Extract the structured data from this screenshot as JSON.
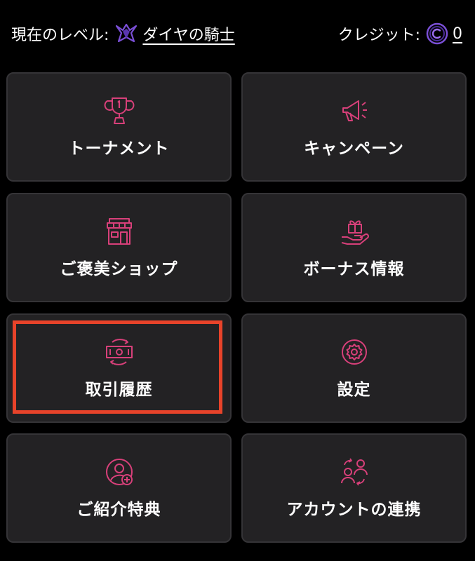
{
  "header": {
    "level_label": "現在のレベル:",
    "level_name": "ダイヤの騎士",
    "level_icon": "knight-crest-icon",
    "credit_label": "クレジット:",
    "credit_value": "0",
    "credit_icon": "coin-icon"
  },
  "menu": [
    {
      "label": "トーナメント",
      "icon": "trophy-icon"
    },
    {
      "label": "キャンペーン",
      "icon": "megaphone-icon"
    },
    {
      "label": "ご褒美ショップ",
      "icon": "shop-icon"
    },
    {
      "label": "ボーナス情報",
      "icon": "gift-hand-icon"
    },
    {
      "label": "取引履歴",
      "icon": "cash-exchange-icon"
    },
    {
      "label": "設定",
      "icon": "gear-icon"
    },
    {
      "label": "ご紹介特典",
      "icon": "user-add-icon"
    },
    {
      "label": "アカウントの連携",
      "icon": "users-link-icon"
    }
  ],
  "highlighted_item": "取引履歴",
  "colors": {
    "background": "#000000",
    "tile_bg": "#232224",
    "tile_border": "#353437",
    "icon_accent": "#d8407a",
    "level_accent": "#7a4fd6",
    "highlight": "#e8432a"
  }
}
